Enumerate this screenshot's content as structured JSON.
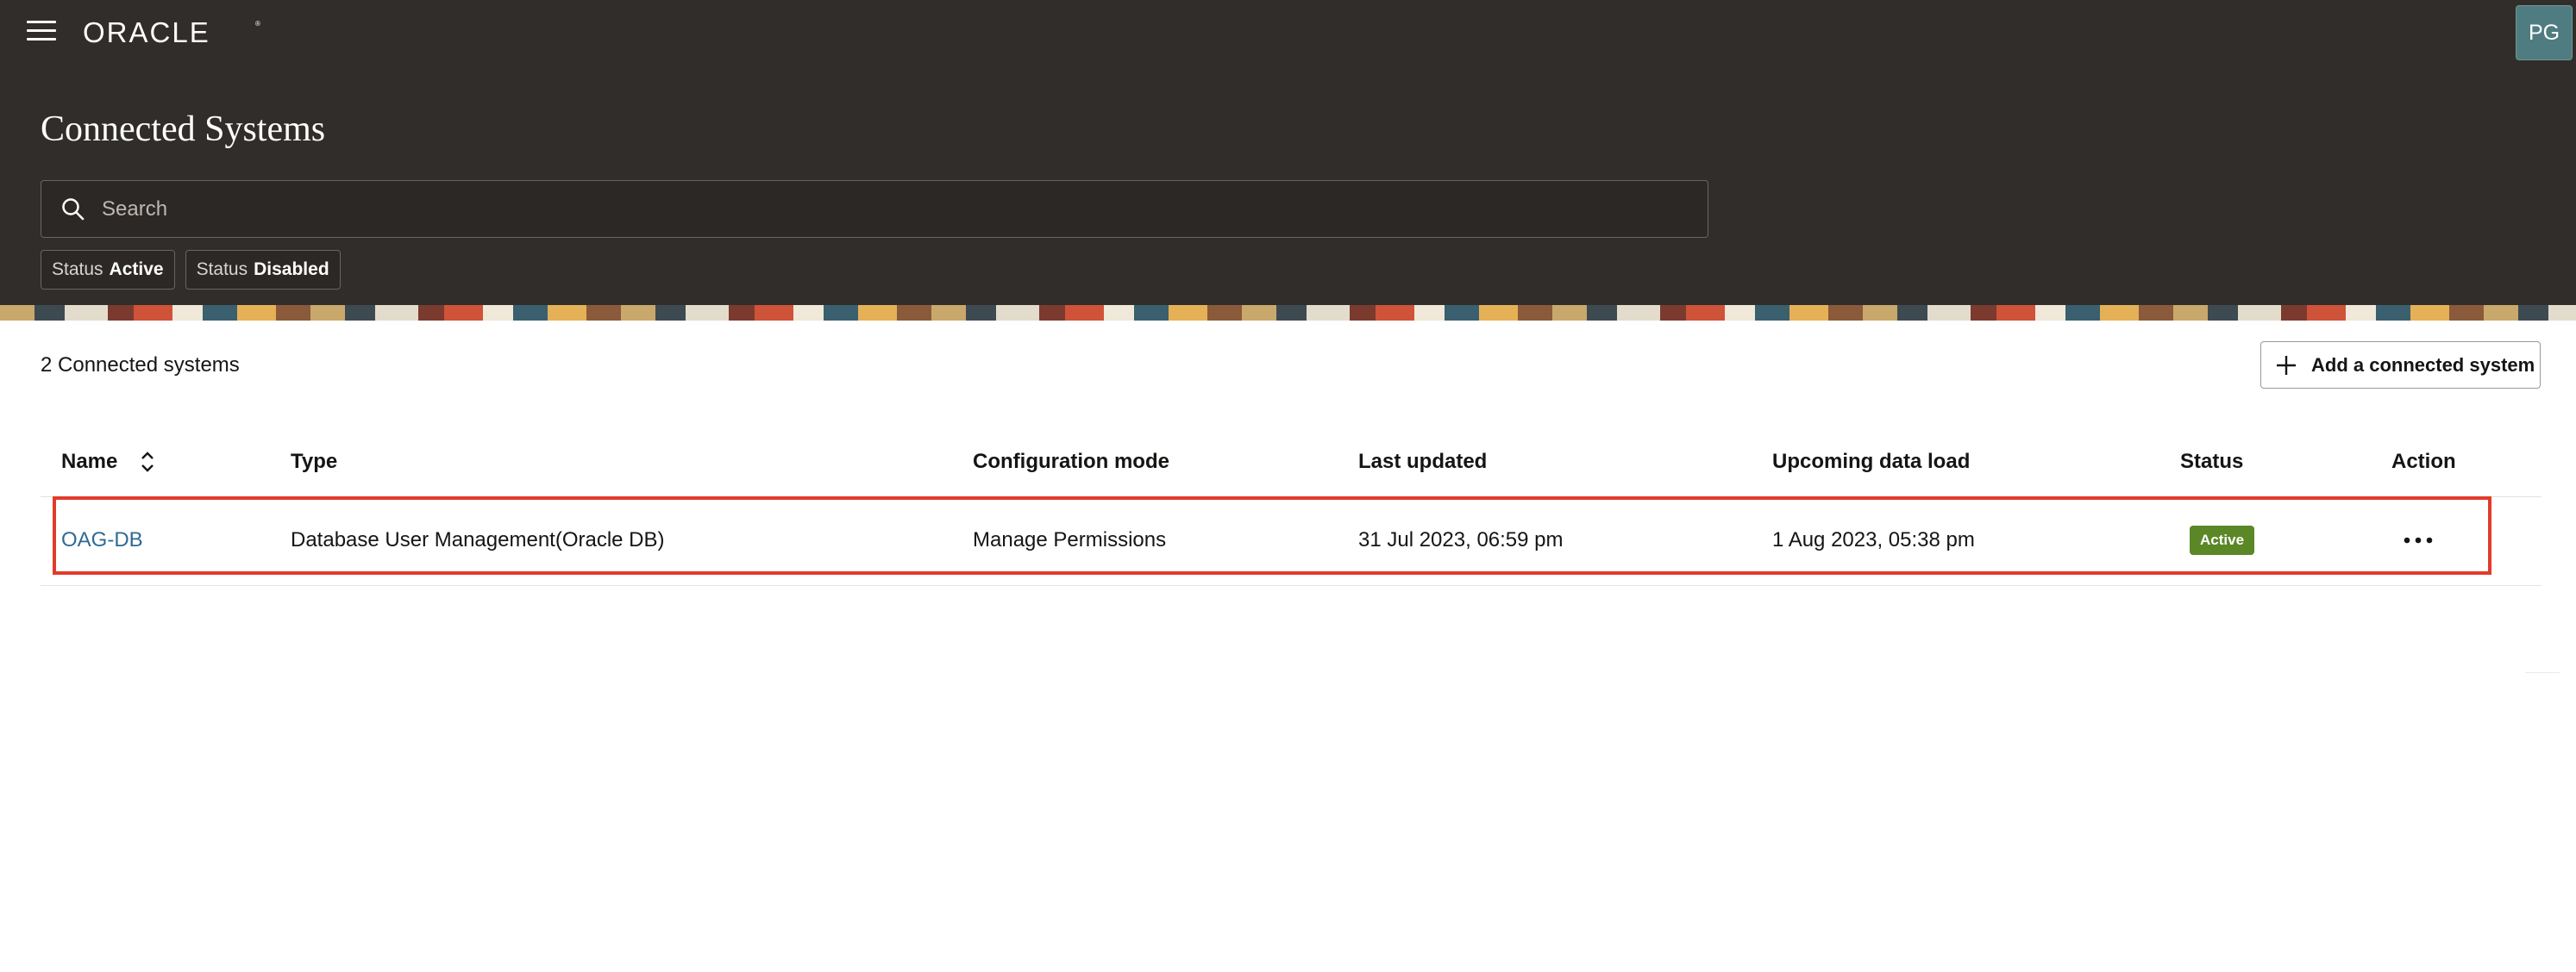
{
  "header": {
    "logo_text": "ORACLE",
    "avatar_initials": "PG",
    "page_title": "Connected Systems",
    "search_placeholder": "Search",
    "filters": [
      {
        "key": "Status",
        "value": "Active"
      },
      {
        "key": "Status",
        "value": "Disabled"
      }
    ]
  },
  "summary": {
    "count_text": "2 Connected systems",
    "add_button_label": "Add a connected system"
  },
  "table": {
    "columns": [
      "Name",
      "Type",
      "Configuration mode",
      "Last updated",
      "Upcoming data load",
      "Status",
      "Action"
    ],
    "rows": [
      {
        "name": "OAG-DB",
        "type": "Database User Management(Oracle DB)",
        "configuration_mode": "Manage Permissions",
        "last_updated": "31 Jul 2023, 06:59 pm",
        "upcoming_data_load": "1 Aug 2023, 05:38 pm",
        "status": "Active"
      }
    ]
  },
  "icons": {
    "menu": "hamburger-menu-icon",
    "search": "search-icon",
    "add": "plus-icon",
    "sort": "sort-icon",
    "more": "more-actions-icon"
  },
  "colors": {
    "header_bg": "#312d2a",
    "link": "#2f6a93",
    "active_badge": "#5b8727",
    "highlight": "#e23b2a"
  }
}
